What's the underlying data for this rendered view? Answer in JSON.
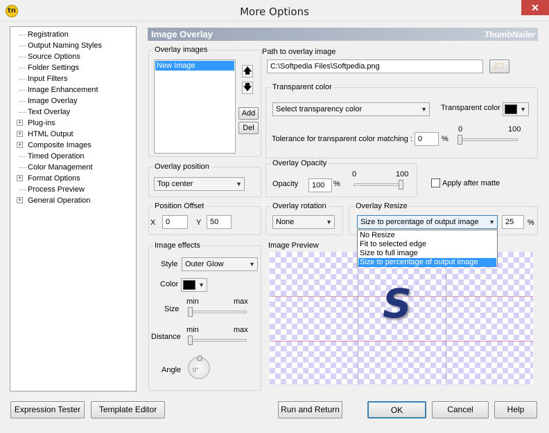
{
  "window": {
    "title": "More Options",
    "close_glyph": "✕",
    "app_icon_text": "tn"
  },
  "tree": {
    "items": [
      {
        "label": "Registration",
        "expandable": false
      },
      {
        "label": "Output Naming Styles",
        "expandable": false
      },
      {
        "label": "Source Options",
        "expandable": false
      },
      {
        "label": "Folder Settings",
        "expandable": false
      },
      {
        "label": "Input Filters",
        "expandable": false
      },
      {
        "label": "Image Enhancement",
        "expandable": false
      },
      {
        "label": "Image Overlay",
        "expandable": false
      },
      {
        "label": "Text Overlay",
        "expandable": false
      },
      {
        "label": "Plug-ins",
        "expandable": true
      },
      {
        "label": "HTML Output",
        "expandable": true
      },
      {
        "label": "Composite Images",
        "expandable": true
      },
      {
        "label": "Timed Operation",
        "expandable": false
      },
      {
        "label": "Color Management",
        "expandable": false
      },
      {
        "label": "Format Options",
        "expandable": true
      },
      {
        "label": "Process Preview",
        "expandable": false
      },
      {
        "label": "General Operation",
        "expandable": true
      }
    ]
  },
  "panel": {
    "title": "Image Overlay",
    "brand": "ThumbNailer"
  },
  "overlay_images": {
    "label": "Overlay images",
    "items": [
      "New Image"
    ],
    "selected": "New Image",
    "up_glyph": "🡅",
    "down_glyph": "🡇",
    "add_label": "Add",
    "del_label": "Del"
  },
  "path": {
    "label": "Path to overlay image",
    "value": "C:\\Softpedia Files\\Softpedia.png"
  },
  "transparent": {
    "label": "Transparent color",
    "mode_value": "Select transparency color",
    "color_label": "Transparent color",
    "color": "#000000",
    "tolerance_label": "Tolerance for transparent color matching :",
    "tolerance_value": "0",
    "pct": "%",
    "min": "0",
    "max": "100",
    "tolerance_fraction": 0
  },
  "position": {
    "label": "Overlay position",
    "value": "Top center"
  },
  "opacity": {
    "label": "Overlay Opacity",
    "field_label": "Opacity",
    "value": "100",
    "pct": "%",
    "min": "0",
    "max": "100",
    "fraction": 1
  },
  "after_matte": {
    "label": "Apply after matte",
    "checked": false
  },
  "offset": {
    "label": "Position Offset",
    "x_label": "X",
    "x_value": "0",
    "y_label": "Y",
    "y_value": "50"
  },
  "rotation": {
    "label": "Overlay rotation",
    "value": "None"
  },
  "resize": {
    "label": "Overlay Resize",
    "value": "Size to percentage of output image",
    "percent_value": "25",
    "pct": "%",
    "options": [
      "No Resize",
      "Fit to selected edge",
      "Size to full image",
      "Size to percentage of output image"
    ],
    "selected_index": 3
  },
  "effects": {
    "label": "Image effects",
    "style_label": "Style",
    "style_value": "Outer Glow",
    "color_label": "Color",
    "color": "#000000",
    "size_label": "Size",
    "distance_label": "Distance",
    "min": "min",
    "max": "max",
    "angle_label": "Angle",
    "angle_value": "0°",
    "size_fraction": 0,
    "distance_fraction": 0
  },
  "preview": {
    "label": "Image Preview",
    "logo_text": "S"
  },
  "buttons": {
    "expression_tester": "Expression Tester",
    "template_editor": "Template Editor",
    "run_and_return": "Run and Return",
    "ok": "OK",
    "cancel": "Cancel",
    "help": "Help"
  },
  "colors": {
    "header_start": "#98a3b5",
    "selection": "#3399ff",
    "close_red": "#c7463f"
  }
}
